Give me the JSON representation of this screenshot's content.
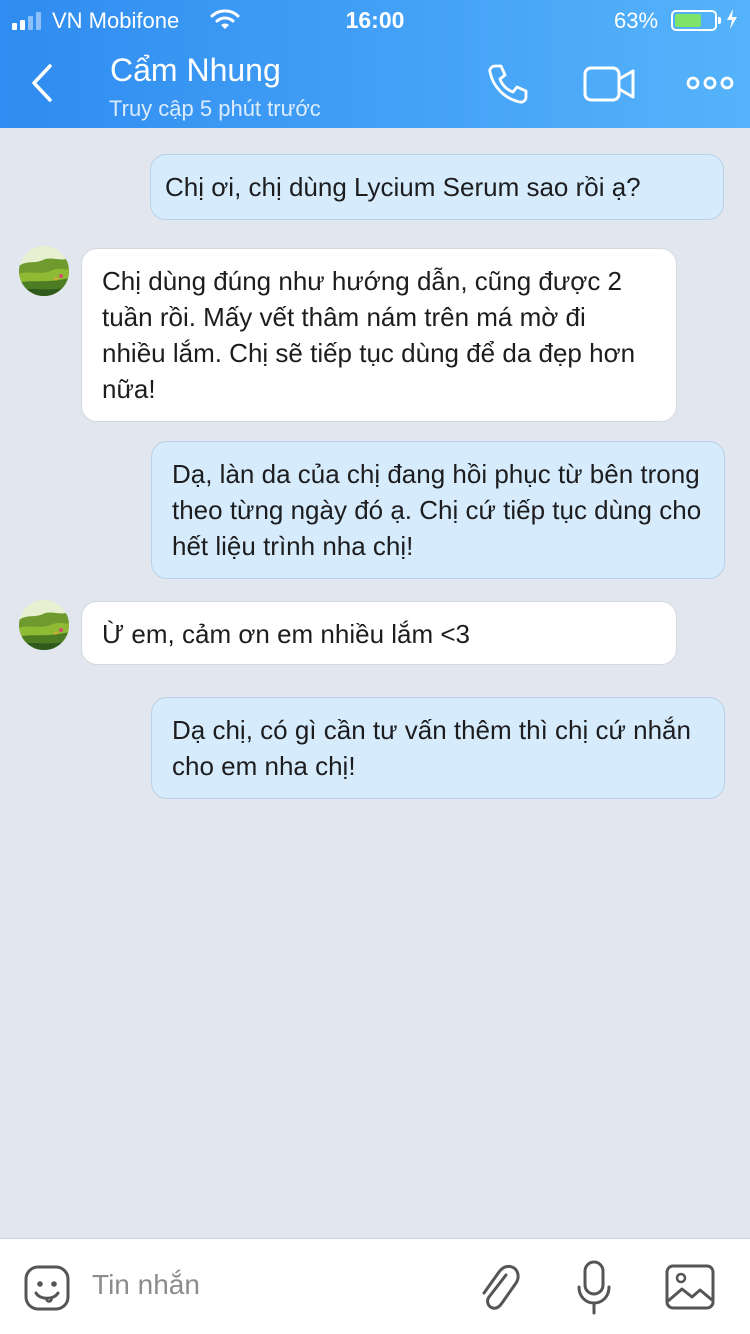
{
  "status_bar": {
    "carrier": "VN Mobifone",
    "time": "16:00",
    "battery": "63%",
    "battery_level": 0.63,
    "signal_bars": 2
  },
  "header": {
    "contact_name": "Cẩm Nhung",
    "contact_status": "Truy cập 5 phút trước",
    "icons": [
      "back-icon",
      "phone-icon",
      "video-camera-icon",
      "more-icon"
    ]
  },
  "messages": [
    {
      "direction": "out",
      "text": "Chị ơi, chị dùng Lycium Serum sao rồi ạ?"
    },
    {
      "direction": "in",
      "text": "Chị dùng đúng như hướng dẫn, cũng được 2 tuần rồi. Mấy vết thâm nám trên má mờ đi nhiều lắm. Chị sẽ tiếp tục dùng để da đẹp hơn nữa!"
    },
    {
      "direction": "out",
      "text": "Dạ, làn da của chị đang hồi phục từ bên trong theo từng ngày đó ạ. Chị cứ tiếp tục dùng cho hết liệu trình nha chị!"
    },
    {
      "direction": "in",
      "text": "Ừ em, cảm ơn em nhiều lắm <3"
    },
    {
      "direction": "out",
      "text": "Dạ chị, có gì cần tư vấn thêm thì chị cứ nhắn cho em nha chị!"
    }
  ],
  "composer": {
    "placeholder": "Tin nhắn",
    "icons": [
      "sticker-icon",
      "paperclip-icon",
      "microphone-icon",
      "image-icon"
    ]
  },
  "colors": {
    "header_gradient_start": "#2f8cf0",
    "header_gradient_end": "#55b3fb",
    "outgoing_bubble": "#d6ecfd",
    "incoming_bubble": "#ffffff",
    "chat_background": "#e2e6ee"
  }
}
